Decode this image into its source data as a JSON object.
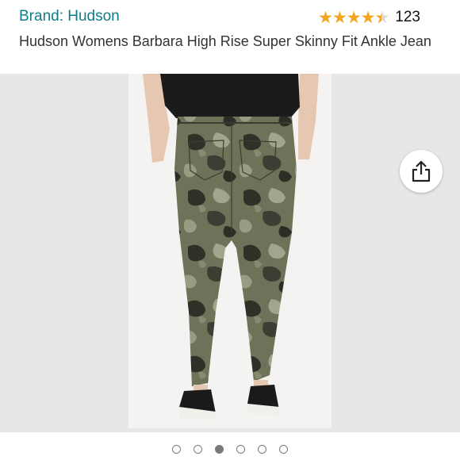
{
  "brand": {
    "label": "Brand: Hudson",
    "color": "#0e7c86"
  },
  "rating": {
    "value": 4.5,
    "max": 5,
    "count": "123",
    "star_color": "#f4a51c"
  },
  "product": {
    "title": "Hudson Womens Barbara High Rise Super Skinny Fit Ankle Jean",
    "image_subject": "camouflage skinny ankle jeans, rear view, with black top and black sneakers"
  },
  "share": {
    "icon": "share-icon"
  },
  "carousel": {
    "total": 6,
    "active_index": 2
  }
}
